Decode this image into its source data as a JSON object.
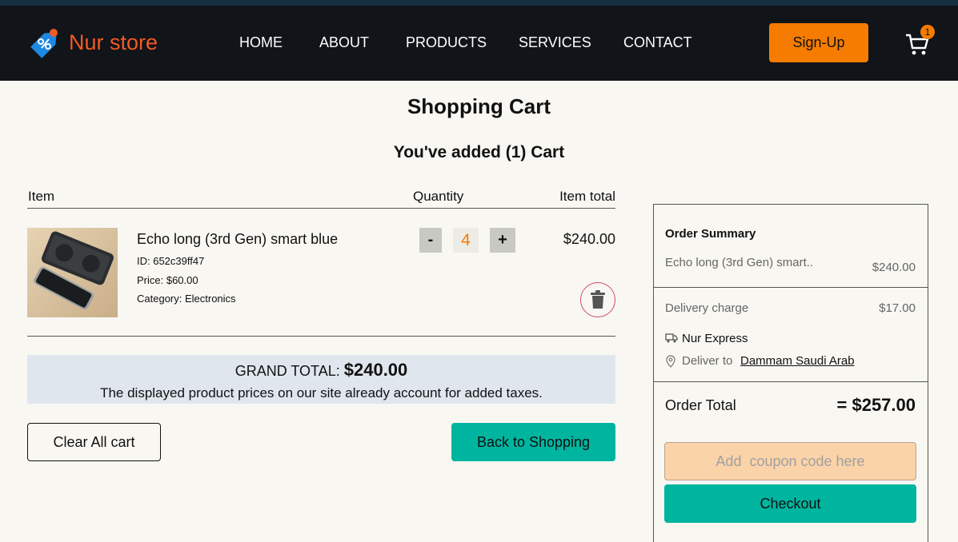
{
  "brand": {
    "name": "Nur store",
    "logo_icon": "price-tag-icon",
    "brand_color": "#f05a24"
  },
  "nav": {
    "home": "HOME",
    "about": "ABOUT",
    "products": "PRODUCTS",
    "services": "SERVICES",
    "contact": "CONTACT"
  },
  "header": {
    "signup_label": "Sign-Up",
    "cart_count": "1",
    "accent_color": "#f57c00"
  },
  "cart": {
    "title": "Shopping Cart",
    "added_text": "You've added (1) Cart",
    "columns": {
      "item": "Item",
      "quantity": "Quantity",
      "item_total": "Item total"
    },
    "items": [
      {
        "name": "Echo long (3rd Gen) smart blue",
        "id_text": "ID: 652c39ff47",
        "price_text": "Price: $60.00",
        "category_text": "Category: Electronics",
        "quantity": "4",
        "decrement_label": "-",
        "increment_label": "+",
        "item_total": "$240.00"
      }
    ],
    "grand_total_label": "GRAND TOTAL:",
    "grand_total_value": "$240.00",
    "tax_note": "The displayed product prices on our site already account for added taxes.",
    "clear_label": "Clear All cart",
    "back_label": "Back to Shopping"
  },
  "summary": {
    "title": "Order Summary",
    "item_name": "Echo long (3rd Gen) smart..",
    "item_price": "$240.00",
    "delivery_label": "Delivery charge",
    "delivery_value": "$17.00",
    "courier": "Nur Express",
    "deliver_to_label": "Deliver to",
    "deliver_to_value": "Dammam Saudi Arab",
    "total_label": "Order Total",
    "total_value": "= $257.00",
    "coupon_placeholder": "Add  coupon code here",
    "checkout_label": "Checkout",
    "teal_color": "#00b5a0"
  }
}
